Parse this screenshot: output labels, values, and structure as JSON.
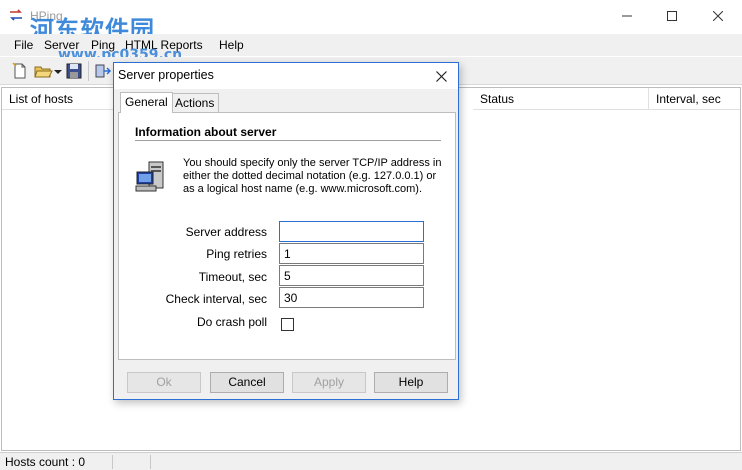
{
  "window": {
    "title": "HPing"
  },
  "watermark": {
    "text": "河东软件园",
    "url": "www.pc0359.cn"
  },
  "menu": [
    "File",
    "Server",
    "Ping",
    "HTML Reports",
    "Help"
  ],
  "list": {
    "columns": [
      "List of hosts",
      "Status",
      "Interval, sec"
    ]
  },
  "statusbar": {
    "text": "Hosts count : 0"
  },
  "dialog": {
    "title": "Server properties",
    "tabs": [
      "General",
      "Actions"
    ],
    "section_title": "Information about server",
    "info": "You should specify only the server TCP/IP address in either the dotted decimal notation (e.g. 127.0.0.1) or as a logical host name (e.g. www.microsoft.com).",
    "fields": {
      "server_address": {
        "label": "Server address",
        "value": ""
      },
      "ping_retries": {
        "label": "Ping retries",
        "value": "1"
      },
      "timeout": {
        "label": "Timeout,  sec",
        "value": "5"
      },
      "check_interval": {
        "label": "Check interval,  sec",
        "value": "30"
      },
      "crash_poll": {
        "label": "Do crash poll",
        "checked": false
      }
    },
    "buttons": {
      "ok": "Ok",
      "cancel": "Cancel",
      "apply": "Apply",
      "help": "Help"
    }
  },
  "colors": {
    "accent": "#2b6fd6",
    "watermark": "#2f7fd8"
  },
  "icons": [
    "app-icon",
    "new-icon",
    "open-icon",
    "save-icon",
    "connect-icon",
    "server-computer-icon"
  ]
}
